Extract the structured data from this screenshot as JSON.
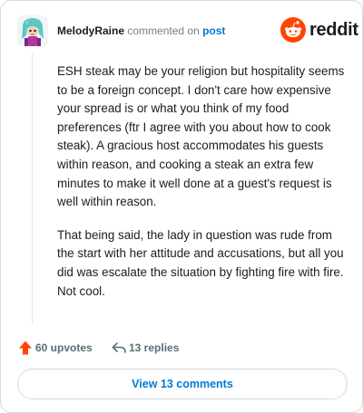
{
  "header": {
    "username": "MelodyRaine",
    "action_text": "commented on",
    "post_link": "post",
    "brand_name": "reddit"
  },
  "comment": {
    "paragraphs": [
      "ESH steak may be your religion but hospitality seems to be a foreign concept. I don't care how expensive your spread is or what you think of my food preferences (ftr I agree with you about how to cook steak). A gracious host accommodates his guests within reason, and cooking a steak an extra few minutes to make it well done at a guest's request is well within reason.",
      "That being said, the lady in question was rude from the start with her attitude and accusations, but all you did was escalate the situation by fighting fire with fire. Not cool."
    ]
  },
  "actions": {
    "upvotes_label": "60 upvotes",
    "replies_label": "13 replies"
  },
  "view_comments_label": "View 13 comments",
  "colors": {
    "upvote": "#ff4500",
    "link": "#0079d3",
    "muted": "#576f76",
    "reddit_orange": "#ff4500"
  },
  "icons": [
    "avatar",
    "reddit-logo-icon",
    "upvote-arrow-icon",
    "reply-arrow-icon"
  ]
}
